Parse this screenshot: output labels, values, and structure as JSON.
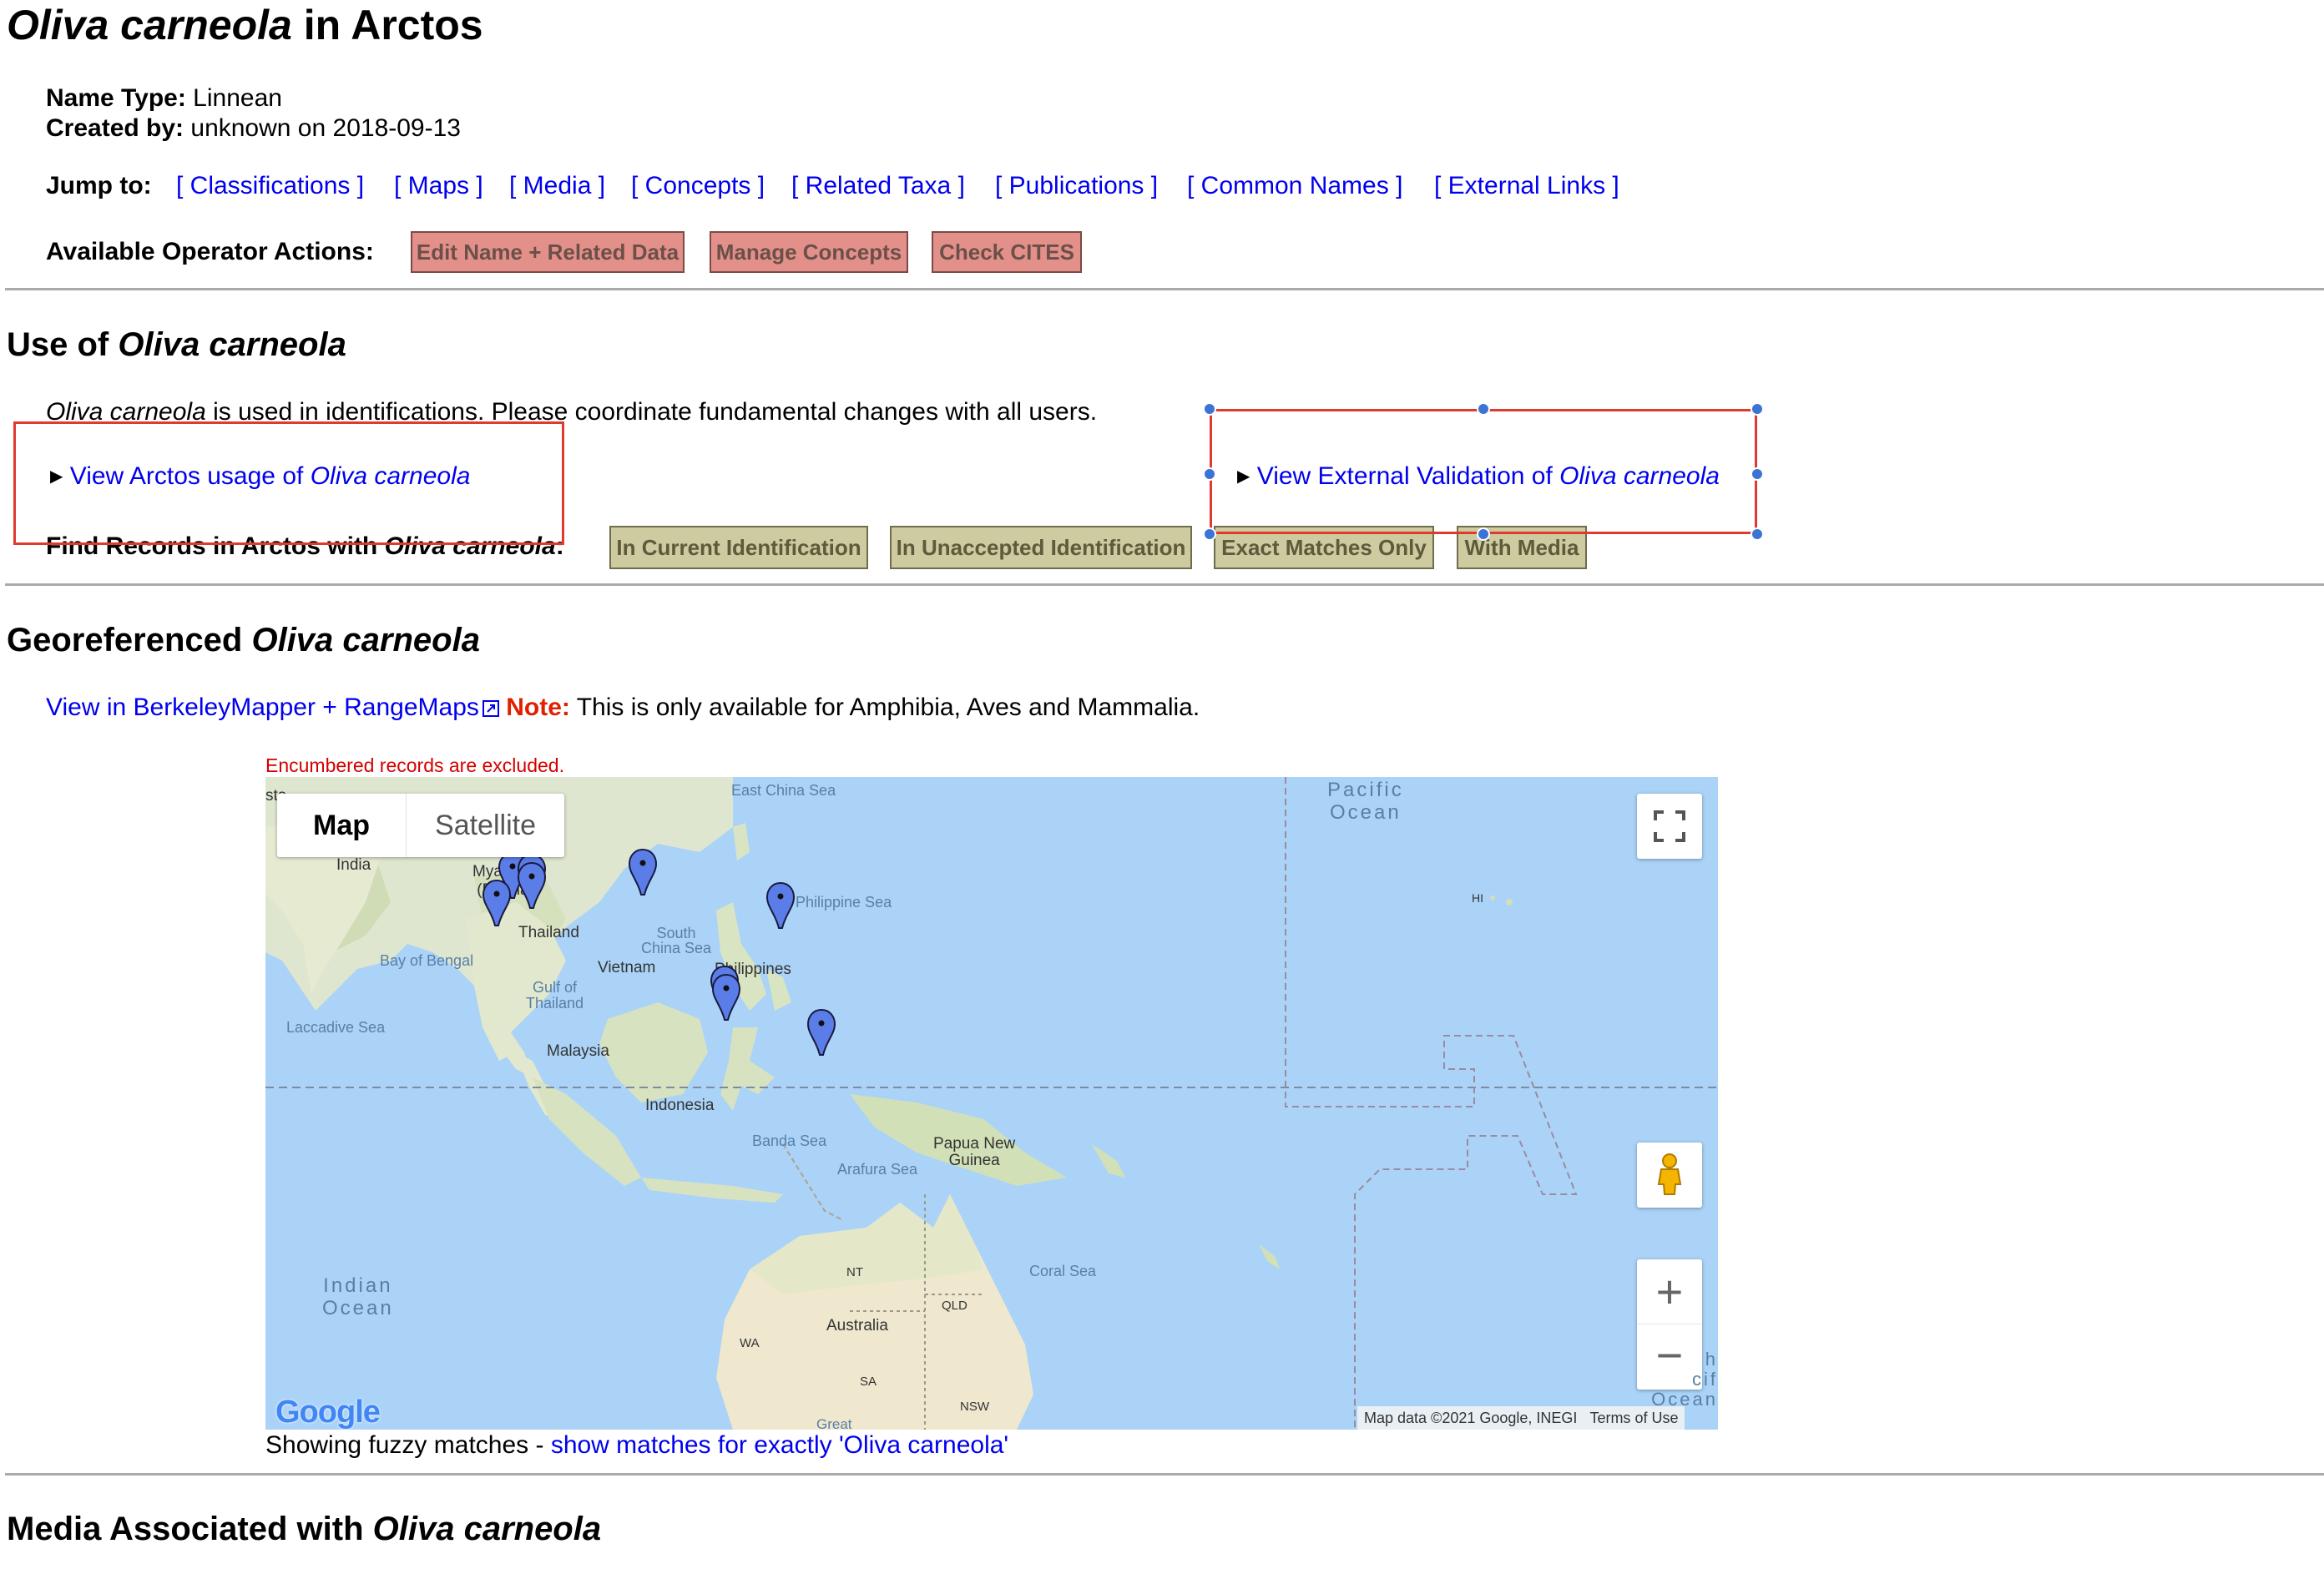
{
  "page": {
    "title_taxon": "Oliva carneola",
    "title_suffix": " in Arctos"
  },
  "meta": {
    "name_type_label": "Name Type:",
    "name_type_value": " Linnean",
    "created_by_label": "Created by:",
    "created_by_value": " unknown on 2018-09-13"
  },
  "jump": {
    "label": "Jump to:",
    "links": [
      "[ Classifications ]",
      "[ Maps ]",
      "[ Media ]",
      "[ Concepts ]",
      "[ Related Taxa ]",
      "[ Publications ]",
      "[ Common Names ]",
      "[ External Links ]"
    ]
  },
  "operator": {
    "label": "Available Operator Actions:",
    "buttons": [
      "Edit Name + Related Data",
      "Manage Concepts",
      "Check CITES"
    ]
  },
  "use": {
    "heading_prefix": "Use of ",
    "heading_taxon": "Oliva carneola",
    "note_taxon": "Oliva carneola",
    "note_text": " is used in identifications. Please coordinate fundamental changes with all users.",
    "usage_prefix": "View Arctos usage of ",
    "usage_taxon": "Oliva carneola",
    "external_prefix": "View External Validation of ",
    "external_taxon": "Oliva carneola",
    "find_label_prefix": "Find Records in Arctos with ",
    "find_label_taxon": "Oliva carneola",
    "find_label_suffix": ":",
    "find_buttons": [
      "In Current Identification",
      "In Unaccepted Identification",
      "Exact Matches Only",
      "With Media"
    ],
    "disclosure_glyph": "▶"
  },
  "georef": {
    "heading_prefix": "Georeferenced ",
    "heading_taxon": "Oliva carneola",
    "mapper_link": "View in BerkeleyMapper + RangeMaps",
    "note_label": "Note:",
    "note_text": " This is only available for Amphibia, Aves and Mammalia.",
    "encumbered": "Encumbered records are excluded.",
    "fuzzy_prefix": "Showing fuzzy matches - ",
    "fuzzy_link": "show matches for exactly 'Oliva carneola'"
  },
  "map": {
    "type_map": "Map",
    "type_satellite": "Satellite",
    "attribution": "Map data ©2021 Google, INEGI",
    "terms": "Terms of Use",
    "logo": "Google",
    "zoom_in": "+",
    "zoom_out": "−",
    "labels": {
      "india": "India",
      "myanmar": "Myanmar\n(Burma)",
      "thailand": "Thailand",
      "vietnam": "Vietnam",
      "philippines": "Philippines",
      "malaysia": "Malaysia",
      "indonesia": "Indonesia",
      "png": "Papua New\nGuinea",
      "australia": "Australia",
      "nt": "NT",
      "qld": "QLD",
      "wa": "WA",
      "sa": "SA",
      "nsw": "NSW",
      "hi": "HI",
      "sta": "sta",
      "great": "Great"
    },
    "seas": {
      "ecs": "East China Sea",
      "phil_sea": "Philippine Sea",
      "scs": "South\nChina Sea",
      "bengal": "Bay of Bengal",
      "thai_gulf": "Gulf of\nThailand",
      "laccadive": "Laccadive Sea",
      "banda": "Banda Sea",
      "arafura": "Arafura Sea",
      "coral": "Coral Sea"
    },
    "oceans": {
      "pacific": "Pacific\nOcean",
      "indian": "Indian\nOcean",
      "right_edge": "h\ncif\nOcean"
    },
    "marker_color": "#5b7de8",
    "marker_count": 9
  },
  "media": {
    "heading_prefix": "Media Associated with ",
    "heading_taxon": "Oliva carneola"
  },
  "colors": {
    "link": "#0000ee",
    "note_red": "#e02000",
    "operator_button": "#e4908a",
    "find_button": "#cdcb9f",
    "selection_box": "#e03a2f",
    "handle": "#3b74d6",
    "water": "#aad3f7"
  },
  "icons": {
    "external_link": "external-link-icon",
    "fullscreen": "fullscreen-icon",
    "pegman": "pegman-icon",
    "map_marker": "map-marker-icon",
    "disclosure": "disclosure-triangle-icon"
  }
}
